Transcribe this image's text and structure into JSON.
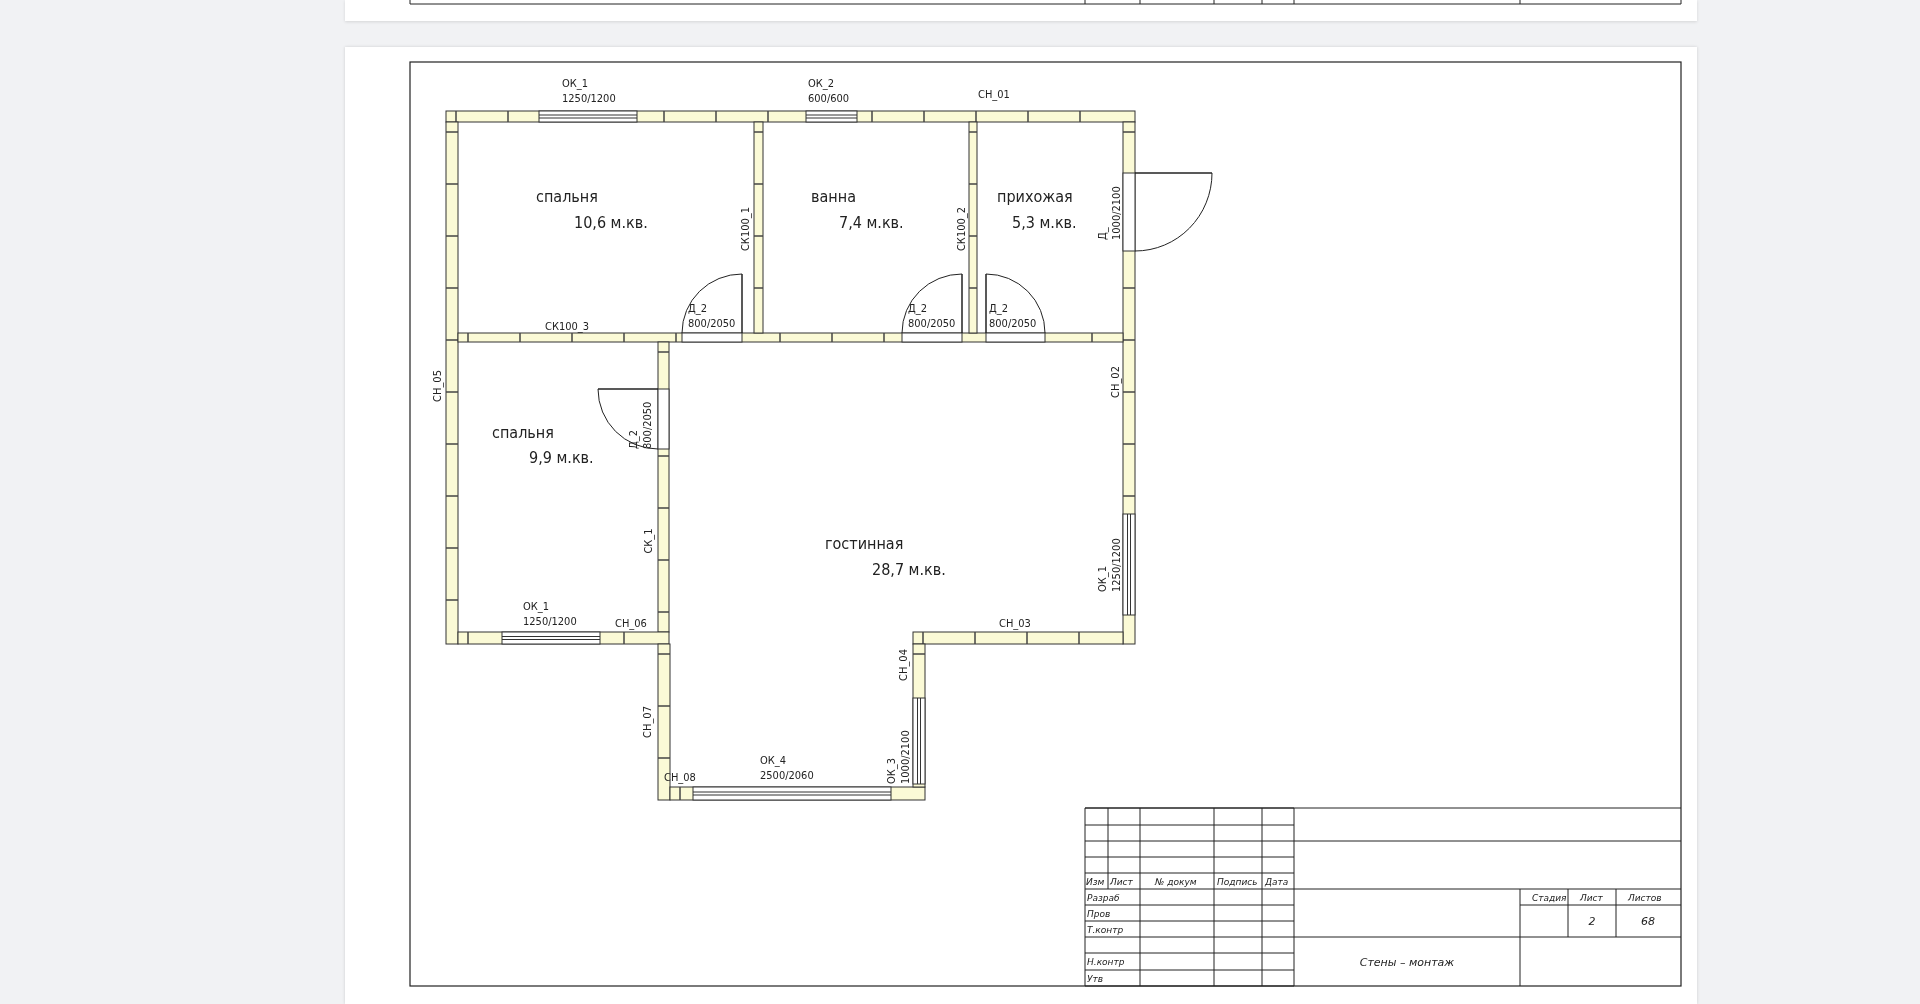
{
  "document": {
    "sheet": {
      "plan": {
        "rooms": [
          {
            "name": "спальня",
            "area": "10,6 м.кв."
          },
          {
            "name": "ванна",
            "area": "7,4 м.кв."
          },
          {
            "name": "прихожая",
            "area": "5,3 м.кв."
          },
          {
            "name": "спальня",
            "area": "9,9 м.кв."
          },
          {
            "name": "гостинная",
            "area": "28,7 м.кв."
          }
        ],
        "wall_marks": [
          "СН_01",
          "СК100_1",
          "СК100_2",
          "СК100_3",
          "СН_05",
          "СН_02",
          "СК_1",
          "СН_06",
          "СН_03",
          "СН_04",
          "СН_07",
          "СН_08"
        ],
        "openings": [
          {
            "kind": "window",
            "mark": "ОК_1",
            "size": "1250/1200"
          },
          {
            "kind": "window",
            "mark": "ОК_2",
            "size": "600/600"
          },
          {
            "kind": "door",
            "mark": "Д_",
            "size": "1000/2100"
          },
          {
            "kind": "door",
            "mark": "Д_2",
            "size": "800/2050"
          },
          {
            "kind": "door",
            "mark": "Д_2",
            "size": "800/2050"
          },
          {
            "kind": "door",
            "mark": "Д_2",
            "size": "800/2050"
          },
          {
            "kind": "door",
            "mark": "Д_2",
            "size": "800/2050"
          },
          {
            "kind": "window",
            "mark": "ОК_1",
            "size": "1250/1200"
          },
          {
            "kind": "window",
            "mark": "ОК_1",
            "size": "1250/1200"
          },
          {
            "kind": "window",
            "mark": "ОК_3",
            "size": "1000/2100"
          },
          {
            "kind": "window",
            "mark": "ОК_4",
            "size": "2500/2060"
          }
        ]
      },
      "title_block": {
        "header_cells": [
          "Изм",
          "Лист",
          "№ докум",
          "Подпись",
          "Дата"
        ],
        "roles": [
          "Разраб",
          "Пров",
          "Т.контр",
          "Н.контр",
          "Утв"
        ],
        "stage_headers": [
          "Стадия",
          "Лист",
          "Листов"
        ],
        "sheet_number": "2",
        "sheet_count": "68",
        "title": "Стены – монтаж"
      }
    }
  }
}
